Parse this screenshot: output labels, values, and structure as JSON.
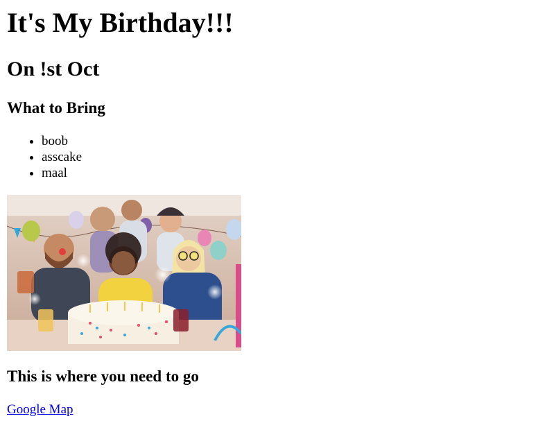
{
  "heading": "It's My Birthday!!!",
  "date": "On !st Oct",
  "bring": {
    "title": "What to Bring",
    "items": [
      "boob",
      "asscake",
      "maal"
    ]
  },
  "photo": {
    "description": "party-photo",
    "colors": {
      "wall": "#e8d6cc",
      "shirt_yellow": "#f2d23e",
      "shirt_blue": "#2d4f8e",
      "cake": "#f6efe2",
      "balloon_green": "#b7c84a",
      "balloon_pink": "#e986b6"
    }
  },
  "directions": {
    "title": "This is where you need to go",
    "link_label": "Google Map"
  },
  "colors": {
    "link": "#0000ee",
    "text": "#000000",
    "background": "#ffffff"
  }
}
